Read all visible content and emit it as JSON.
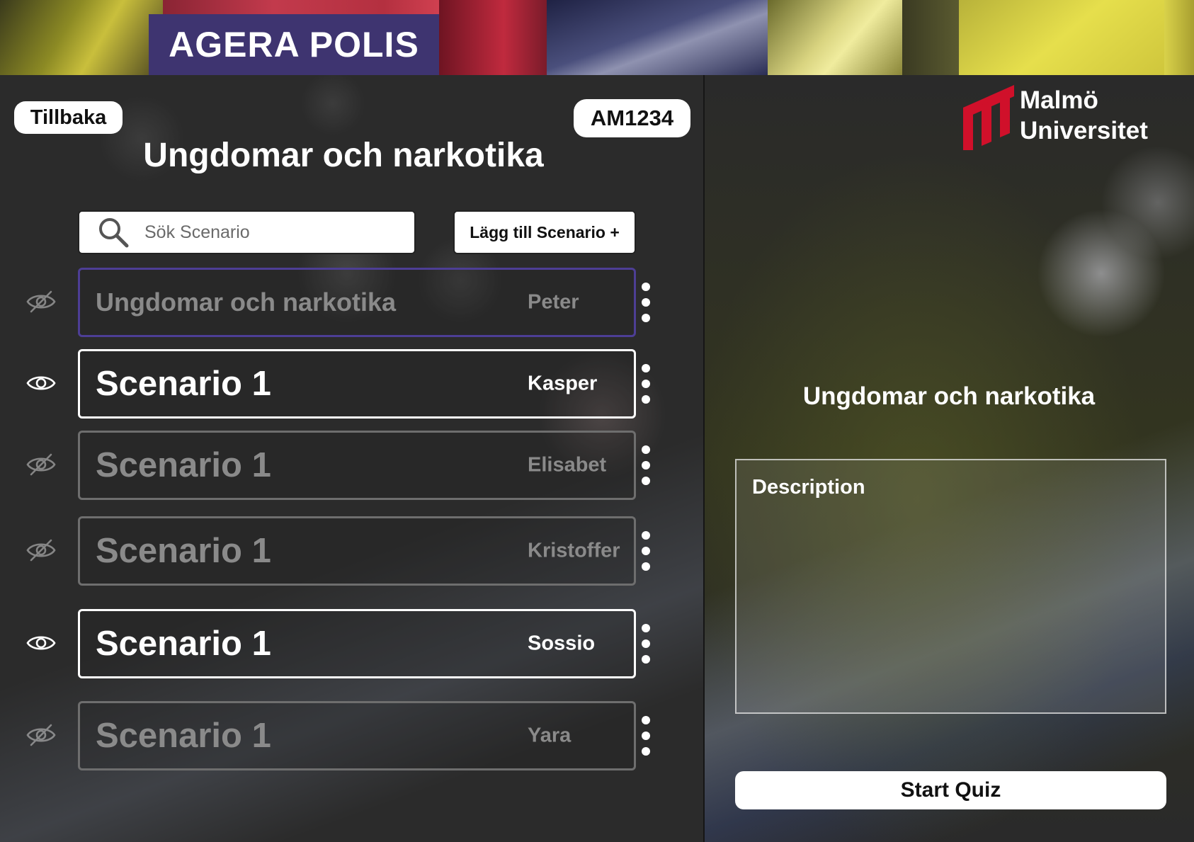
{
  "header": {
    "brand_title": "AGERA POLIS"
  },
  "left": {
    "back_label": "Tillbaka",
    "course_code": "AM1234",
    "page_title": "Ungdomar och narkotika",
    "search": {
      "placeholder": "Sök Scenario",
      "value": "",
      "icon": "search-icon"
    },
    "add_label": "Lägg till Scenario +",
    "scenarios": [
      {
        "title": "Ungdomar och narkotika",
        "author": "Peter",
        "visible": false,
        "selected": true,
        "icon": "eye-slash-icon"
      },
      {
        "title": "Scenario 1",
        "author": "Kasper",
        "visible": true,
        "selected": false,
        "icon": "eye-icon"
      },
      {
        "title": "Scenario 1",
        "author": "Elisabet",
        "visible": false,
        "selected": false,
        "icon": "eye-slash-icon"
      },
      {
        "title": "Scenario 1",
        "author": "Kristoffer",
        "visible": false,
        "selected": false,
        "icon": "eye-slash-icon"
      },
      {
        "title": "Scenario 1",
        "author": "Sossio",
        "visible": true,
        "selected": false,
        "icon": "eye-icon"
      },
      {
        "title": "Scenario 1",
        "author": "Yara",
        "visible": false,
        "selected": false,
        "icon": "eye-slash-icon"
      }
    ]
  },
  "right": {
    "university": {
      "line1": "Malmö",
      "line2": "Universitet",
      "logo_color": "#d0102a"
    },
    "preview_title": "Ungdomar och narkotika",
    "description_label": "Description",
    "start_label": "Start Quiz"
  },
  "colors": {
    "brand_box": "#3e3470",
    "selected_border": "#4d3e95",
    "panel_background": "#2b2b2b"
  }
}
